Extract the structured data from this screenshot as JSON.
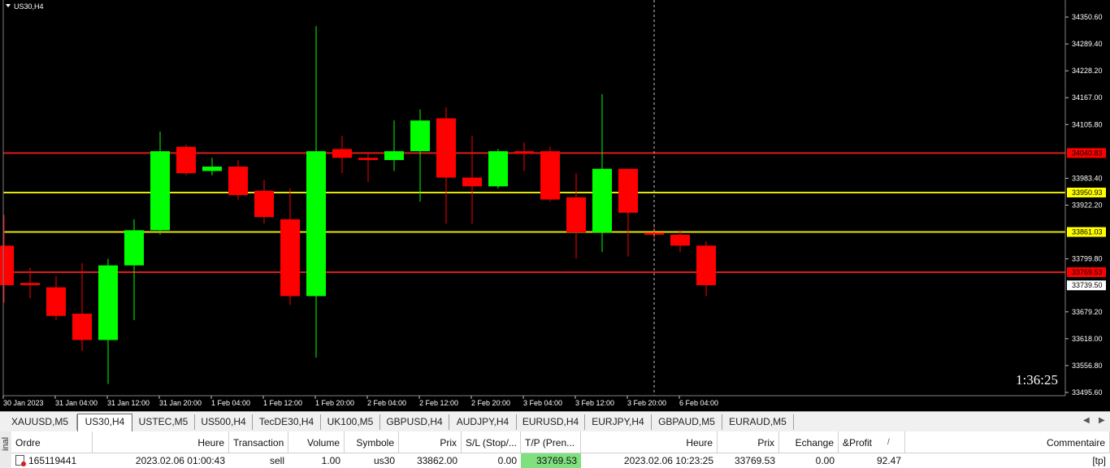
{
  "chart": {
    "symbol_label": "US30,H4",
    "timer": "1:36:25",
    "colors": {
      "background": "#000000",
      "bull": "#00ff00",
      "bear": "#ff0000",
      "wick_bull": "#00ff00",
      "wick_bear": "#ff0000",
      "resistance_line": "#d91c1c",
      "support_line": "#e6e600"
    },
    "price_levels": [
      {
        "name": "level-34040",
        "value": 34040.83,
        "label": "34040.83",
        "color": "#d91c1c",
        "badge": "#ff0000",
        "badge_text": "#000000"
      },
      {
        "name": "level-33950",
        "value": 33950.93,
        "label": "33950.93",
        "color": "#e6e600",
        "badge": "#ffff00",
        "badge_text": "#000000"
      },
      {
        "name": "level-33861",
        "value": 33861.03,
        "label": "33861.03",
        "color": "#e6e600",
        "badge": "#ffff00",
        "badge_text": "#000000"
      },
      {
        "name": "level-33769",
        "value": 33769.53,
        "label": "33769.53",
        "color": "#d91c1c",
        "badge": "#ff0000",
        "badge_text": "#000000"
      },
      {
        "name": "level-bid",
        "value": 33739.5,
        "label": "33739.50",
        "color": null,
        "badge": "#ffffff",
        "badge_text": "#000000"
      }
    ]
  },
  "chart_data": {
    "type": "candlestick",
    "title": "US30,H4",
    "y_ticks": [
      "34350.60",
      "34289.40",
      "34228.20",
      "34167.00",
      "34105.80",
      "33983.40",
      "33922.20",
      "33799.80",
      "33679.20",
      "33618.00",
      "33556.80",
      "33495.60"
    ],
    "ylim": [
      33495.6,
      34350.6
    ],
    "x_ticks": [
      "30 Jan 2023",
      "31 Jan 04:00",
      "31 Jan 12:00",
      "31 Jan 20:00",
      "1 Feb 04:00",
      "1 Feb 12:00",
      "1 Feb 20:00",
      "2 Feb 04:00",
      "2 Feb 12:00",
      "2 Feb 20:00",
      "3 Feb 04:00",
      "3 Feb 12:00",
      "3 Feb 20:00",
      "6 Feb 04:00"
    ],
    "candles": [
      {
        "o": 33830,
        "h": 33900,
        "l": 33700,
        "c": 33740
      },
      {
        "o": 33745,
        "h": 33780,
        "l": 33710,
        "c": 33740
      },
      {
        "o": 33735,
        "h": 33760,
        "l": 33660,
        "c": 33670
      },
      {
        "o": 33675,
        "h": 33790,
        "l": 33590,
        "c": 33615
      },
      {
        "o": 33615,
        "h": 33800,
        "l": 33515,
        "c": 33785
      },
      {
        "o": 33785,
        "h": 33890,
        "l": 33660,
        "c": 33865
      },
      {
        "o": 33865,
        "h": 34090,
        "l": 33855,
        "c": 34045
      },
      {
        "o": 34055,
        "h": 34060,
        "l": 33990,
        "c": 33995
      },
      {
        "o": 34000,
        "h": 34030,
        "l": 33990,
        "c": 34010
      },
      {
        "o": 34010,
        "h": 34025,
        "l": 33935,
        "c": 33945
      },
      {
        "o": 33955,
        "h": 33980,
        "l": 33880,
        "c": 33895
      },
      {
        "o": 33890,
        "h": 33960,
        "l": 33695,
        "c": 33715
      },
      {
        "o": 33715,
        "h": 34330,
        "l": 33575,
        "c": 34045
      },
      {
        "o": 34050,
        "h": 34080,
        "l": 33995,
        "c": 34030
      },
      {
        "o": 34030,
        "h": 34040,
        "l": 33975,
        "c": 34025
      },
      {
        "o": 34025,
        "h": 34115,
        "l": 34000,
        "c": 34045
      },
      {
        "o": 34045,
        "h": 34140,
        "l": 33930,
        "c": 34115
      },
      {
        "o": 34120,
        "h": 34145,
        "l": 33880,
        "c": 33985
      },
      {
        "o": 33985,
        "h": 34080,
        "l": 33880,
        "c": 33965
      },
      {
        "o": 33965,
        "h": 34050,
        "l": 33960,
        "c": 34045
      },
      {
        "o": 34045,
        "h": 34065,
        "l": 34000,
        "c": 34040
      },
      {
        "o": 34045,
        "h": 34055,
        "l": 33930,
        "c": 33935
      },
      {
        "o": 33940,
        "h": 33995,
        "l": 33800,
        "c": 33860
      },
      {
        "o": 33860,
        "h": 34175,
        "l": 33815,
        "c": 34005
      },
      {
        "o": 34005,
        "h": 34000,
        "l": 33805,
        "c": 33905
      },
      {
        "o": 33860,
        "h": 33880,
        "l": 33845,
        "c": 33855
      },
      {
        "o": 33855,
        "h": 33865,
        "l": 33815,
        "c": 33830
      },
      {
        "o": 33830,
        "h": 33840,
        "l": 33715,
        "c": 33740
      }
    ]
  },
  "tabs": [
    {
      "label": "XAUUSD,M5",
      "active": false
    },
    {
      "label": "US30,H4",
      "active": true
    },
    {
      "label": "USTEC,M5",
      "active": false
    },
    {
      "label": "US500,H4",
      "active": false
    },
    {
      "label": "TecDE30,H4",
      "active": false
    },
    {
      "label": "UK100,M5",
      "active": false
    },
    {
      "label": "GBPUSD,H4",
      "active": false
    },
    {
      "label": "AUDJPY,H4",
      "active": false
    },
    {
      "label": "EURUSD,H4",
      "active": false
    },
    {
      "label": "EURJPY,H4",
      "active": false
    },
    {
      "label": "GBPAUD,M5",
      "active": false
    },
    {
      "label": "EURAUD,M5",
      "active": false
    }
  ],
  "terminal": {
    "side_label": "inal",
    "columns": [
      "Ordre",
      "Heure",
      "Transaction",
      "Volume",
      "Symbole",
      "Prix",
      "S/L (Stop/...",
      "T/P (Pren...",
      "Heure",
      "Prix",
      "Echange",
      "&Profit",
      "Commentaire"
    ],
    "sort_indicator": "/",
    "rows": [
      {
        "ordre": "165119441",
        "heure": "2023.02.06 01:00:43",
        "transaction": "sell",
        "volume": "1.00",
        "symbole": "us30",
        "prix": "33862.00",
        "sl": "0.00",
        "tp": "33769.53",
        "heure2": "2023.02.06 10:23:25",
        "prix2": "33769.53",
        "echange": "0.00",
        "profit": "92.47",
        "commentaire": "[tp]"
      }
    ]
  }
}
